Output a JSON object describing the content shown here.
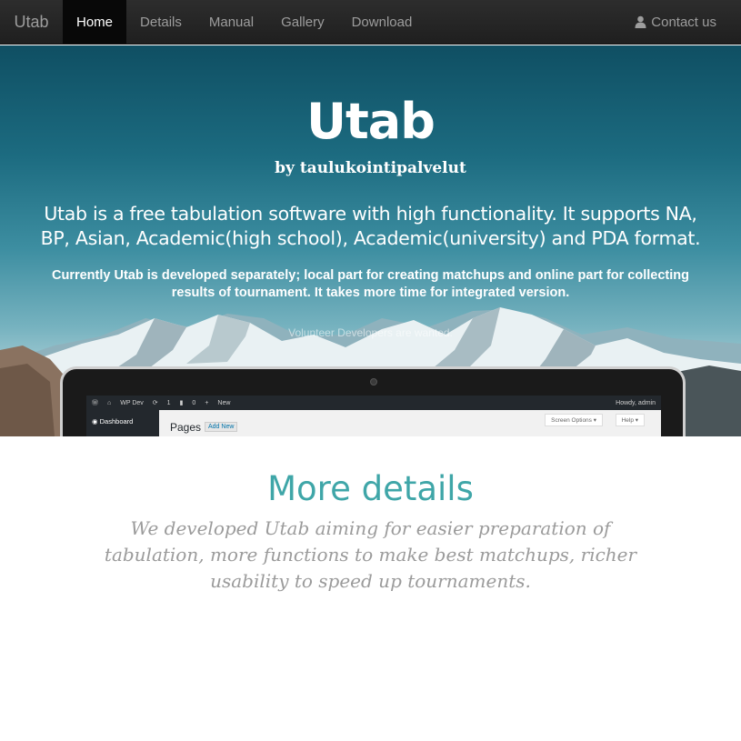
{
  "navbar": {
    "brand": "Utab",
    "items": [
      {
        "label": "Home",
        "active": true
      },
      {
        "label": "Details",
        "active": false
      },
      {
        "label": "Manual",
        "active": false
      },
      {
        "label": "Gallery",
        "active": false
      },
      {
        "label": "Download",
        "active": false
      }
    ],
    "contact_label": "Contact us",
    "contact_icon": "user-icon"
  },
  "hero": {
    "title": "Utab",
    "byline": "by taulukointipalvelut",
    "lead": "Utab is a free tabulation software with high functionality. It supports NA, BP, Asian, Academic(high school), Academic(university) and PDA format.",
    "note": "Currently Utab is developed separately; local part for creating matchups and online part for collecting results of tournament. It takes more time for integrated version.",
    "volunteer": "Volunteer Developers are wanted.",
    "screenshot": {
      "site_name": "WP Dev",
      "updates_count": "1",
      "comments_count": "0",
      "new_label": "New",
      "howdy": "Howdy, admin",
      "sidebar_item": "Dashboard",
      "page_heading": "Pages",
      "add_new": "Add New",
      "screen_options": "Screen Options ▾",
      "help": "Help ▾"
    }
  },
  "details": {
    "heading": "More details",
    "text": "We developed Utab aiming for easier preparation of tabulation, more functions to make best matchups, richer usability to speed up tournaments."
  },
  "colors": {
    "navbar_bg": "#222222",
    "nav_active_bg": "#080808",
    "nav_text": "#9d9d9d",
    "accent": "#3fa6a8",
    "details_text": "#9b9b9b"
  }
}
